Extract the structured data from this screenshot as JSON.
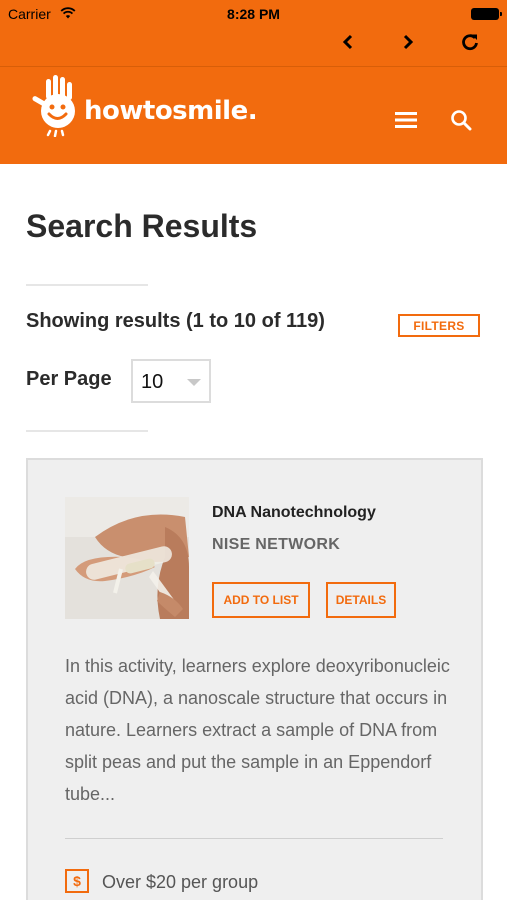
{
  "status_bar": {
    "carrier": "Carrier",
    "time": "8:28 PM"
  },
  "browser_nav": {
    "back_icon": "chevron-left-icon",
    "forward_icon": "chevron-right-icon",
    "reload_icon": "reload-icon"
  },
  "header": {
    "logo_text": "howtosmile.",
    "menu_icon": "hamburger-icon",
    "search_icon": "search-icon",
    "brand_color": "#f26b0e"
  },
  "page": {
    "title": "Search Results",
    "results_text": "Showing results (1 to 10 of 119)",
    "filters_label": "FILTERS",
    "per_page_label": "Per Page",
    "per_page_value": "10"
  },
  "results": [
    {
      "title": "DNA Nanotechnology",
      "org": "NISE NETWORK",
      "add_label": "ADD TO LIST",
      "details_label": "DETAILS",
      "description": "In this activity, learners explore deoxyribonucleic acid (DNA), a nanoscale structure that occurs in nature. Learners extract a sample of DNA from split peas and put the sample in an Eppendorf tube...",
      "price_icon": "$",
      "price": "Over $20 per group"
    }
  ]
}
